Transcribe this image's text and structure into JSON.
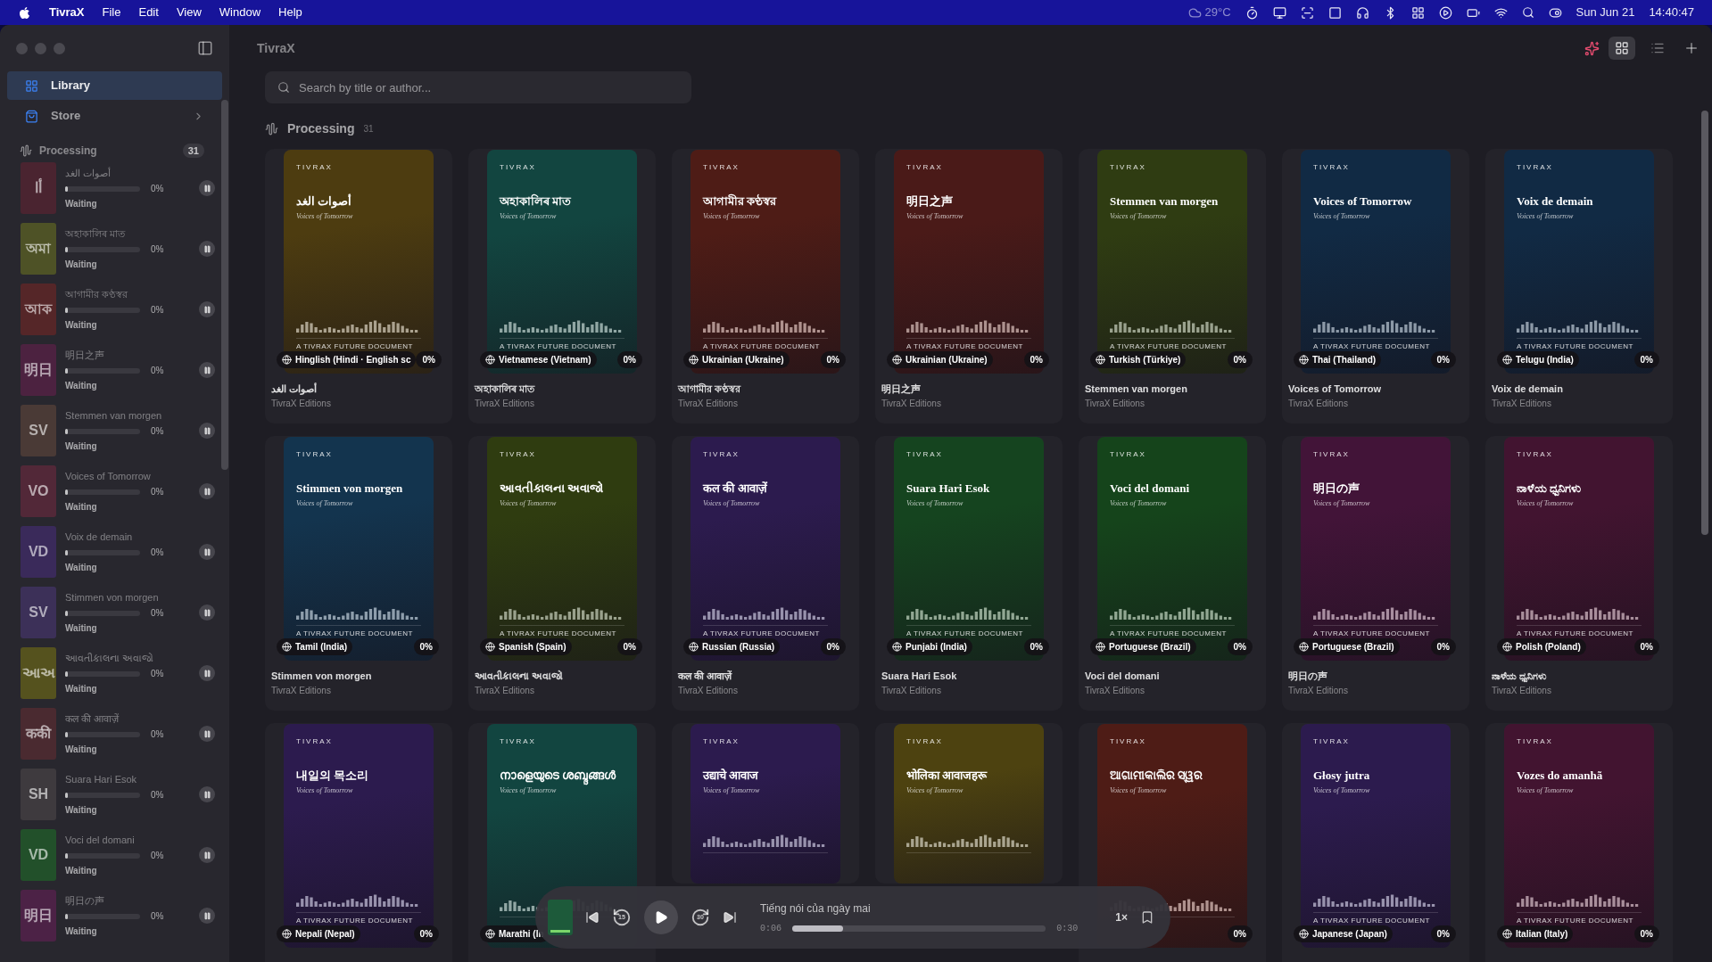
{
  "menu_bar": {
    "app": "TivraX",
    "menus": [
      "File",
      "Edit",
      "View",
      "Window",
      "Help"
    ],
    "weather": "29°C",
    "date": "Sun Jun 21",
    "time": "14:40:47"
  },
  "window": {
    "title": "TivraX"
  },
  "view_modes": [
    {
      "kind": "grid",
      "selected": true
    },
    {
      "kind": "list",
      "selected": false
    }
  ],
  "sidebar": {
    "nav": [
      {
        "kind": "library",
        "label": "Library",
        "selected": true
      },
      {
        "kind": "store",
        "label": "Store",
        "selected": false
      }
    ],
    "section": {
      "label": "Processing",
      "count": "31"
    },
    "queue": [
      {
        "title": "أصوات الغد",
        "initials": "أا",
        "color": "#4a2430",
        "percent": "0%",
        "status": "Waiting",
        "level": 0.02
      },
      {
        "title": "অহাকালিৰ মাত",
        "initials": "অমা",
        "color": "#4e5226",
        "percent": "0%",
        "status": "Waiting",
        "level": 0.02
      },
      {
        "title": "আগামীর কণ্ঠস্বর",
        "initials": "আক",
        "color": "#552628",
        "percent": "0%",
        "status": "Waiting",
        "level": 0.02
      },
      {
        "title": "明日之声",
        "initials": "明日",
        "color": "#4c2240",
        "percent": "0%",
        "status": "Waiting",
        "level": 0.02
      },
      {
        "title": "Stemmen van morgen",
        "initials": "SV",
        "color": "#4a3a36",
        "percent": "0%",
        "status": "Waiting",
        "level": 0.02
      },
      {
        "title": "Voices of Tomorrow",
        "initials": "VO",
        "color": "#522838",
        "percent": "0%",
        "status": "Waiting",
        "level": 0.02
      },
      {
        "title": "Voix de demain",
        "initials": "VD",
        "color": "#3a2a5a",
        "percent": "0%",
        "status": "Waiting",
        "level": 0.02
      },
      {
        "title": "Stimmen von morgen",
        "initials": "SV",
        "color": "#3c3058",
        "percent": "0%",
        "status": "Waiting",
        "level": 0.02
      },
      {
        "title": "આવતીકાલના અવાજો",
        "initials": "આઅ",
        "color": "#55521e",
        "percent": "0%",
        "status": "Waiting",
        "level": 0.02
      },
      {
        "title": "कल की आवाज़ें",
        "initials": "ककी",
        "color": "#4a2a30",
        "percent": "0%",
        "status": "Waiting",
        "level": 0.02
      },
      {
        "title": "Suara Hari Esok",
        "initials": "SH",
        "color": "#3e3a3e",
        "percent": "0%",
        "status": "Waiting",
        "level": 0.02
      },
      {
        "title": "Voci del domani",
        "initials": "VD",
        "color": "#22502a",
        "percent": "0%",
        "status": "Waiting",
        "level": 0.02
      },
      {
        "title": "明日の声",
        "initials": "明日",
        "color": "#4c2246",
        "percent": "0%",
        "status": "Waiting",
        "level": 0.02
      }
    ]
  },
  "search": {
    "placeholder": "Search by title or author..."
  },
  "section": {
    "label": "Processing",
    "count": "31"
  },
  "books": [
    {
      "cover_title": "أصوات الغد",
      "brand": "TIVRAX",
      "subtitle": "Voices of Tomorrow",
      "tagline": "A TIVRAX FUTURE DOCUMENT",
      "color": "#4d3c10",
      "language": "Hinglish (Hindi · English sc",
      "percent": "0%",
      "title": "أصوات الغد",
      "author": "TivraX Editions"
    },
    {
      "cover_title": "অহাকালিৰ মাত",
      "brand": "TIVRAX",
      "subtitle": "Voices of Tomorrow",
      "tagline": "A TIVRAX FUTURE DOCUMENT",
      "color": "#124540",
      "language": "Vietnamese (Vietnam)",
      "percent": "0%",
      "title": "অহাকালিৰ মাত",
      "author": "TivraX Editions"
    },
    {
      "cover_title": "আগামীর কণ্ঠস্বর",
      "brand": "TIVRAX",
      "subtitle": "Voices of Tomorrow",
      "tagline": "A TIVRAX FUTURE DOCUMENT",
      "color": "#4e1c16",
      "language": "Ukrainian (Ukraine)",
      "percent": "0%",
      "title": "আগামীর কণ্ঠস্বর",
      "author": "TivraX Editions"
    },
    {
      "cover_title": "明日之声",
      "brand": "TIVRAX",
      "subtitle": "Voices of Tomorrow",
      "tagline": "A TIVRAX FUTURE DOCUMENT",
      "color": "#4a1a18",
      "language": "Ukrainian (Ukraine)",
      "percent": "0%",
      "title": "明日之声",
      "author": "TivraX Editions"
    },
    {
      "cover_title": "Stemmen van morgen",
      "brand": "TIVRAX",
      "subtitle": "Voices of Tomorrow",
      "tagline": "A TIVRAX FUTURE DOCUMENT",
      "color": "#2f3c12",
      "language": "Turkish (Türkiye)",
      "percent": "0%",
      "title": "Stemmen van morgen",
      "author": "TivraX Editions"
    },
    {
      "cover_title": "Voices of Tomorrow",
      "brand": "TIVRAX",
      "subtitle": "Voices of Tomorrow",
      "tagline": "A TIVRAX FUTURE DOCUMENT",
      "color": "#112a44",
      "language": "Thai (Thailand)",
      "percent": "0%",
      "title": "Voices of Tomorrow",
      "author": "TivraX Editions"
    },
    {
      "cover_title": "Voix de demain",
      "brand": "TIVRAX",
      "subtitle": "Voices of Tomorrow",
      "tagline": "A TIVRAX FUTURE DOCUMENT",
      "color": "#112a44",
      "language": "Telugu (India)",
      "percent": "0%",
      "title": "Voix de demain",
      "author": "TivraX Editions"
    },
    {
      "cover_title": "Stimmen von morgen",
      "brand": "TIVRAX",
      "subtitle": "Voices of Tomorrow",
      "tagline": "A TIVRAX FUTURE DOCUMENT",
      "color": "#13344e",
      "language": "Tamil (India)",
      "percent": "0%",
      "title": "Stimmen von morgen",
      "author": "TivraX Editions"
    },
    {
      "cover_title": "આવતીકાલના અવાજો",
      "brand": "TIVRAX",
      "subtitle": "Voices of Tomorrow",
      "tagline": "A TIVRAX FUTURE DOCUMENT",
      "color": "#2f3c10",
      "language": "Spanish (Spain)",
      "percent": "0%",
      "title": "આવતીકાલના અવાજો",
      "author": "TivraX Editions"
    },
    {
      "cover_title": "कल की आवाज़ें",
      "brand": "TIVRAX",
      "subtitle": "Voices of Tomorrow",
      "tagline": "A TIVRAX FUTURE DOCUMENT",
      "color": "#2c1b4e",
      "language": "Russian (Russia)",
      "percent": "0%",
      "title": "कल की आवाज़ें",
      "author": "TivraX Editions"
    },
    {
      "cover_title": "Suara Hari Esok",
      "brand": "TIVRAX",
      "subtitle": "Voices of Tomorrow",
      "tagline": "A TIVRAX FUTURE DOCUMENT",
      "color": "#15441f",
      "language": "Punjabi (India)",
      "percent": "0%",
      "title": "Suara Hari Esok",
      "author": "TivraX Editions"
    },
    {
      "cover_title": "Voci del domani",
      "brand": "TIVRAX",
      "subtitle": "Voices of Tomorrow",
      "tagline": "A TIVRAX FUTURE DOCUMENT",
      "color": "#15441b",
      "language": "Portuguese (Brazil)",
      "percent": "0%",
      "title": "Voci del domani",
      "author": "TivraX Editions"
    },
    {
      "cover_title": "明日の声",
      "brand": "TIVRAX",
      "subtitle": "Voices of Tomorrow",
      "tagline": "A TIVRAX FUTURE DOCUMENT",
      "color": "#421438",
      "language": "Portuguese (Brazil)",
      "percent": "0%",
      "title": "明日の声",
      "author": "TivraX Editions"
    },
    {
      "cover_title": "ನಾಳೆಯ ಧ್ವನಿಗಳು",
      "brand": "TIVRAX",
      "subtitle": "Voices of Tomorrow",
      "tagline": "A TIVRAX FUTURE DOCUMENT",
      "color": "#421430",
      "language": "Polish (Poland)",
      "percent": "0%",
      "title": "ನಾಳೆಯ ಧ್ವನಿಗಳು",
      "author": "TivraX Editions"
    },
    {
      "cover_title": "내일의 목소리",
      "brand": "TIVRAX",
      "subtitle": "Voices of Tomorrow",
      "tagline": "A TIVRAX FUTURE DOCUMENT",
      "color": "#2c1b4e",
      "language": "Nepali (Nepal)",
      "percent": "0%"
    },
    {
      "cover_title": "നാളെയുടെ ശബ്ദങ്ങൾ",
      "brand": "TIVRAX",
      "subtitle": "Voices of Tomorrow",
      "color": "#124540",
      "language": "Marathi (In"
    },
    {
      "cover_title": "उद्याचे आवाज",
      "brand": "TIVRAX",
      "subtitle": "Voices of Tomorrow",
      "color": "#2c1b4e"
    },
    {
      "cover_title": "भोलिका आवाजहरू",
      "brand": "TIVRAX",
      "subtitle": "Voices of Tomorrow",
      "color": "#4d4210"
    },
    {
      "cover_title": "ଆଗାମୀକାଲିର ସ୍ୱର",
      "brand": "TIVRAX",
      "subtitle": "Voices of Tomorrow",
      "color": "#4e1c16",
      "percent": "0%"
    },
    {
      "cover_title": "Głosy jutra",
      "brand": "TIVRAX",
      "subtitle": "Voices of Tomorrow",
      "tagline": "A TIVRAX FUTURE DOCUMENT",
      "color": "#2c1b4e",
      "language": "Japanese (Japan)",
      "percent": "0%"
    },
    {
      "cover_title": "Vozes do amanhã",
      "brand": "TIVRAX",
      "subtitle": "Voices of Tomorrow",
      "tagline": "A TIVRAX FUTURE DOCUMENT",
      "color": "#421430",
      "language": "Italian (Italy)",
      "percent": "0%"
    }
  ],
  "player": {
    "title": "Tiếng nói của ngày mai",
    "skip_back": "15",
    "skip_forward": "30",
    "elapsed": "0:06",
    "total": "0:30",
    "level": 0.2,
    "speed": "1×",
    "playing": false
  }
}
